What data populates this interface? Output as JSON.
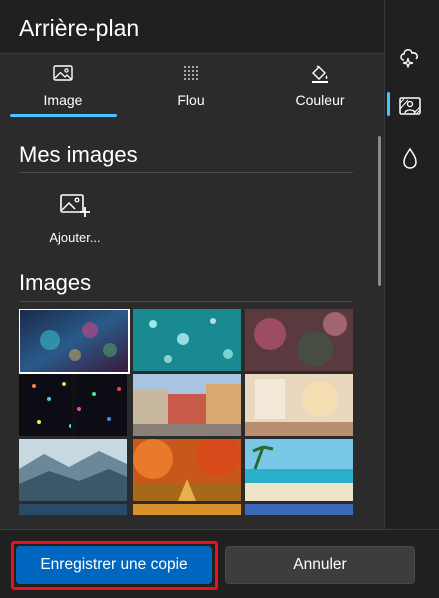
{
  "header": {
    "title": "Arrière-plan"
  },
  "tabs": [
    {
      "label": "Image",
      "icon": "image-icon",
      "active": true
    },
    {
      "label": "Flou",
      "icon": "blur-icon",
      "active": false
    },
    {
      "label": "Couleur",
      "icon": "paint-bucket-icon",
      "active": false
    }
  ],
  "my_images": {
    "title": "Mes images",
    "add_label": "Ajouter..."
  },
  "images": {
    "title": "Images",
    "thumbnails": [
      {
        "name": "rain-neon",
        "selected": true
      },
      {
        "name": "teal-bokeh",
        "selected": false
      },
      {
        "name": "pink-bokeh",
        "selected": false
      },
      {
        "name": "colorful-dots",
        "selected": false
      },
      {
        "name": "venice-street",
        "selected": false
      },
      {
        "name": "cozy-room",
        "selected": false
      },
      {
        "name": "misty-mountains",
        "selected": false
      },
      {
        "name": "autumn-park",
        "selected": false
      },
      {
        "name": "tropical-beach",
        "selected": false
      }
    ]
  },
  "footer": {
    "save_label": "Enregistrer une copie",
    "cancel_label": "Annuler"
  },
  "rail": [
    {
      "icon": "effects-icon"
    },
    {
      "icon": "background-icon",
      "active": true
    },
    {
      "icon": "drop-icon"
    }
  ],
  "colors": {
    "accent": "#0067c0",
    "highlight": "#e81123",
    "underline": "#4cc2ff"
  }
}
